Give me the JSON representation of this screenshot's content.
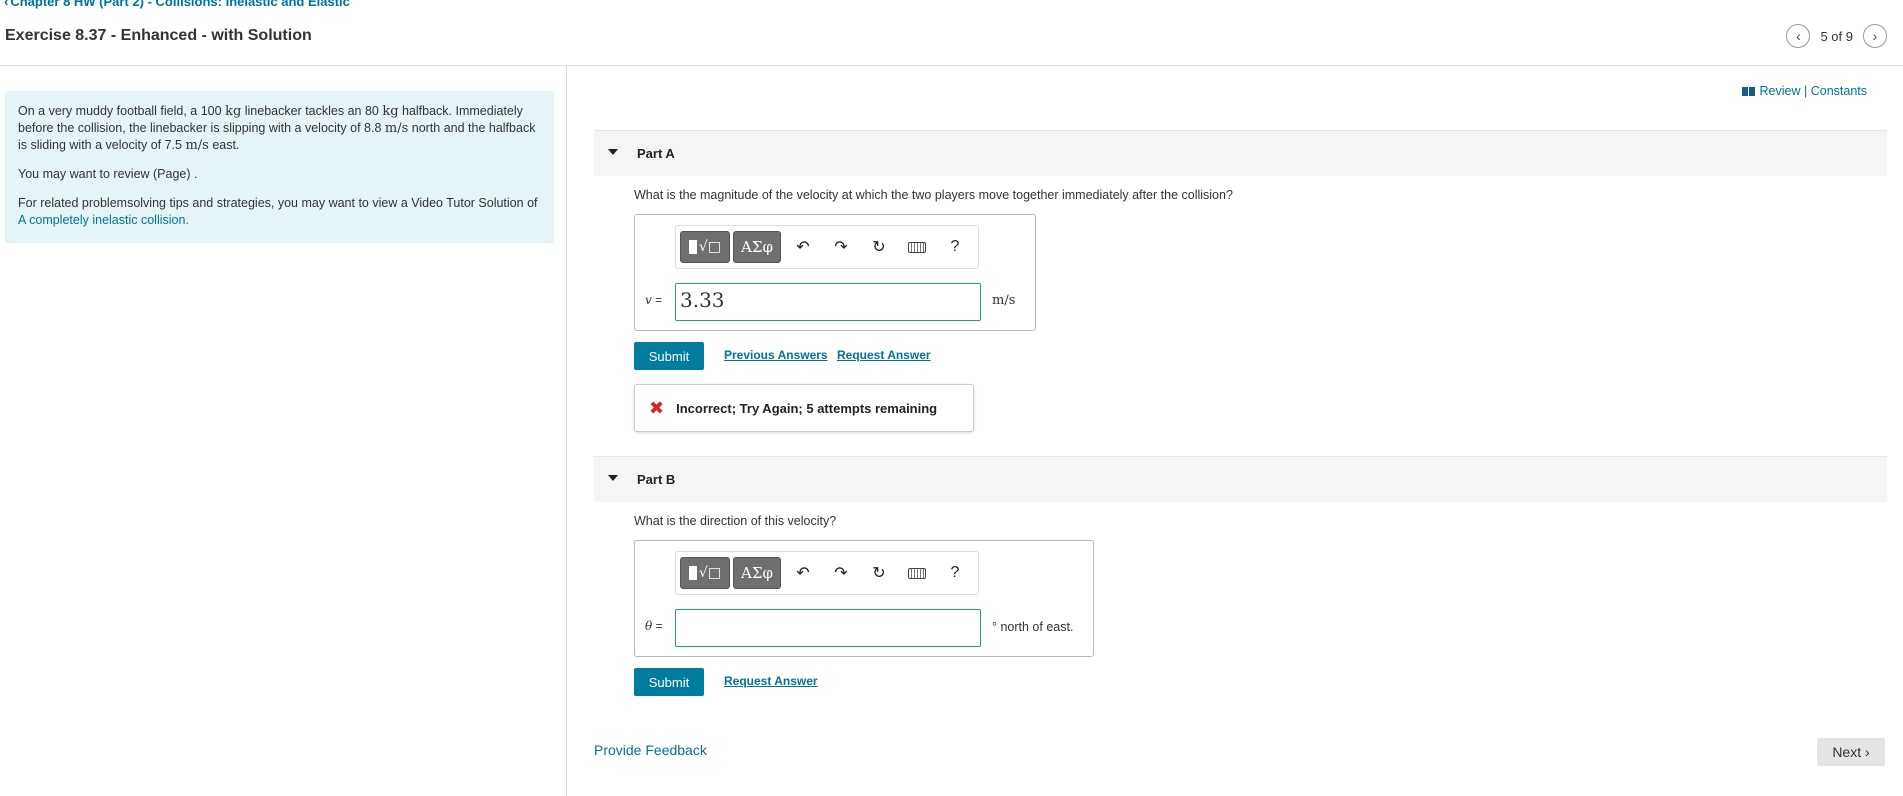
{
  "header": {
    "breadcrumb": "Chapter 8 HW (Part 2) - Collisions: Inelastic and Elastic",
    "title": "Exercise 8.37 - Enhanced - with Solution",
    "pager": "5 of 9"
  },
  "problem": {
    "p1_a": "On a very muddy football field, a 100 ",
    "p1_kg1": "kg",
    "p1_b": " linebacker tackles an 80 ",
    "p1_kg2": "kg",
    "p1_c": " halfback. Immediately before the collision, the linebacker is slipping with a velocity of 8.8 ",
    "p1_unit1": "m/s",
    "p1_d": " north and the halfback is sliding with a velocity of 7.5 ",
    "p1_unit2": "m/s",
    "p1_e": " east.",
    "p2": "You may want to review (Page) .",
    "p3_a": "For related problemsolving tips and strategies, you may want to view a Video Tutor Solution of ",
    "p3_link": "A completely inelastic collision."
  },
  "review_link": "Review | Constants",
  "toolbar": {
    "greek": "ΑΣφ",
    "help": "?"
  },
  "partA": {
    "title": "Part A",
    "question": "What is the magnitude of the velocity at which the two players move together immediately after the collision?",
    "var": "v",
    "eq": " =",
    "value": "3.33",
    "unit": "m/s",
    "submit": "Submit",
    "prev_answers": "Previous Answers",
    "request_answer": "Request Answer",
    "feedback": "Incorrect; Try Again; 5 attempts remaining"
  },
  "partB": {
    "title": "Part B",
    "question": "What is the direction of this velocity?",
    "var": "θ",
    "eq": " =",
    "value": "",
    "unit": "° north of east.",
    "submit": "Submit",
    "request_answer": "Request Answer"
  },
  "footer": {
    "provide_feedback": "Provide Feedback",
    "next": "Next"
  }
}
